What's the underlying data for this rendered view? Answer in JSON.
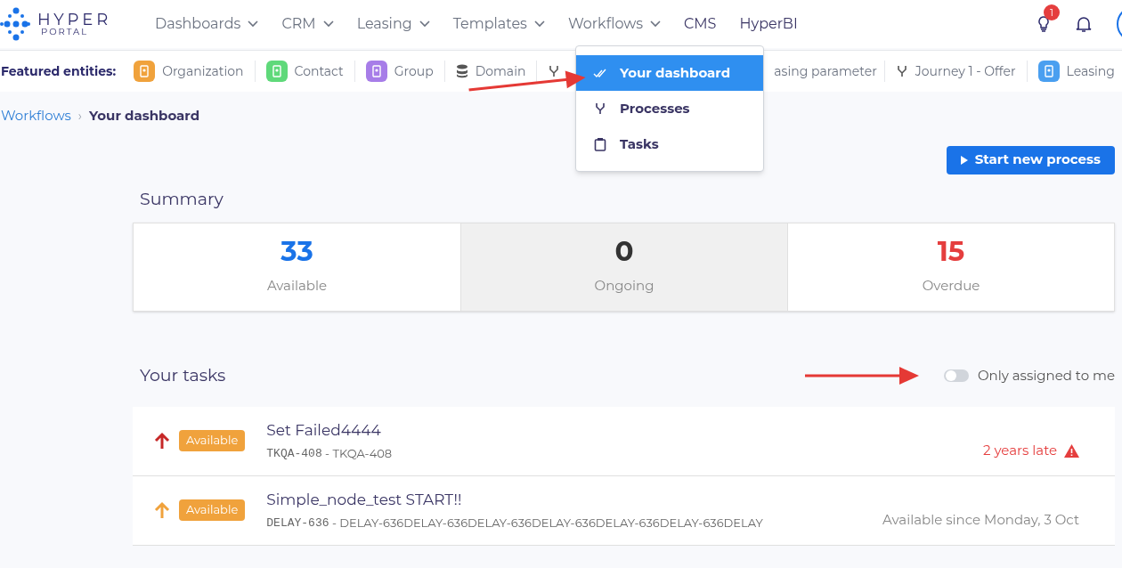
{
  "brand": {
    "name": "HYPER",
    "sub": "PORTAL"
  },
  "nav": [
    {
      "label": "Dashboards",
      "dropdown": true
    },
    {
      "label": "CRM",
      "dropdown": true
    },
    {
      "label": "Leasing",
      "dropdown": true
    },
    {
      "label": "Templates",
      "dropdown": true
    },
    {
      "label": "Workflows",
      "dropdown": true
    },
    {
      "label": "CMS",
      "dropdown": false
    },
    {
      "label": "HyperBI",
      "dropdown": false
    }
  ],
  "notifications": {
    "badge": "1"
  },
  "featured": {
    "label": "Featured entities:",
    "items": [
      {
        "label": "Organization",
        "kind": "building",
        "color": "#f0a23c"
      },
      {
        "label": "Contact",
        "kind": "contact",
        "color": "#5fd97a"
      },
      {
        "label": "Group",
        "kind": "group",
        "color": "#a77de8"
      },
      {
        "label": "Domain",
        "kind": "database"
      },
      {
        "kind": "flow"
      },
      {
        "label": "asing parameter",
        "kind": "none"
      },
      {
        "label": "Journey 1 - Offer",
        "kind": "flow"
      },
      {
        "label": "Leasing",
        "kind": "document",
        "color": "#4a9ff0"
      }
    ]
  },
  "menu": [
    {
      "label": "Your dashboard",
      "kind": "check",
      "selected": true
    },
    {
      "label": "Processes",
      "kind": "flow",
      "selected": false
    },
    {
      "label": "Tasks",
      "kind": "clipboard",
      "selected": false
    }
  ],
  "breadcrumb": [
    {
      "label": "Workflows"
    },
    {
      "label": "Your dashboard"
    }
  ],
  "breadcrumb_separator": "›",
  "start_button": "Start new process",
  "summary": {
    "title": "Summary",
    "cards": [
      {
        "value": "33",
        "label": "Available",
        "color": "#1a73e8",
        "selected": false
      },
      {
        "value": "0",
        "label": "Ongoing",
        "color": "#333333",
        "selected": true
      },
      {
        "value": "15",
        "label": "Overdue",
        "color": "#e53e3e",
        "selected": false
      }
    ]
  },
  "tasks": {
    "title": "Your tasks",
    "filter": {
      "label": "Only assigned to me",
      "on": false
    },
    "rows": [
      {
        "title": "Set Failed4444",
        "status": "Available",
        "code": "TKQA-408",
        "ref": " - TKQA-408",
        "color": "#c62828",
        "due": "2 years late",
        "late": true
      },
      {
        "title": "Simple_node_test START!!",
        "status": "Available",
        "code": "DELAY-636",
        "ref": " - DELAY-636DELAY-636DELAY-636DELAY-636DELAY-636DELAY-636DELAY",
        "color": "#f0a23c",
        "due": "Available since Monday, 3 Oct",
        "late": false
      }
    ]
  }
}
